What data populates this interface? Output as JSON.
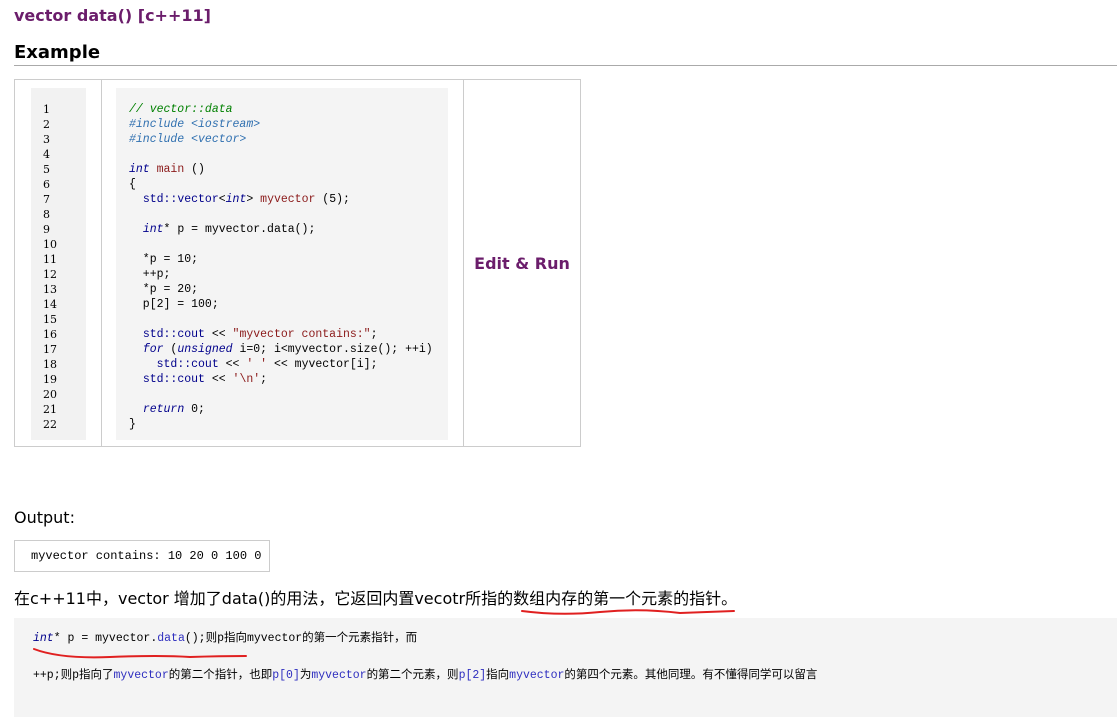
{
  "page": {
    "title": "vector data() [c++11]",
    "section": "Example",
    "edit_run": "Edit & Run",
    "output_label": "Output:",
    "output_text": "myvector contains: 10 20 0 100 0",
    "explanation": "在c++11中，vector 增加了data()的用法，它返回内置vecotr所指的数组内存的第一个元素的指针。"
  },
  "code": {
    "line_numbers": [
      "1",
      "2",
      "3",
      "4",
      "5",
      "6",
      "7",
      "8",
      "9",
      "10",
      "11",
      "12",
      "13",
      "14",
      "15",
      "16",
      "17",
      "18",
      "19",
      "20",
      "21",
      "22"
    ]
  },
  "note": {
    "line1": {
      "kw": "int",
      "rest": "* p = myvector.",
      "fn": "data",
      "tail": "();则p指向myvector的第一个元素指针，而"
    },
    "line2": {
      "p1": "++p;则p指向了",
      "b1": "myvector",
      "p2": "的第二个指针，也即",
      "b2": "p[0]",
      "p3": "为",
      "b3": "myvector",
      "p4": "的第二个元素，则",
      "b4": "p[2]",
      "p5": "指向",
      "b5": "myvector",
      "p6": "的第四个元素。其他同理。有不懂得同学可以留言"
    }
  },
  "annotation_color": "#e02020"
}
